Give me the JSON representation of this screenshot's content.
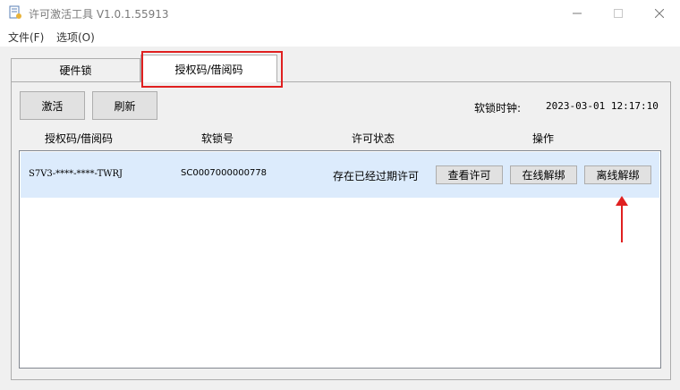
{
  "window": {
    "title": "许可激活工具 V1.0.1.55913"
  },
  "menu": [
    {
      "label": "文件(F)"
    },
    {
      "label": "选项(O)"
    }
  ],
  "tabs": [
    {
      "label": "硬件锁"
    },
    {
      "label": "授权码/借阅码"
    }
  ],
  "toolbar": {
    "activate_label": "激活",
    "refresh_label": "刷新",
    "clock_label": "软锁时钟:",
    "clock_value": "2023-03-01 12:17:10"
  },
  "table": {
    "headers": [
      "授权码/借阅码",
      "软锁号",
      "许可状态",
      "操作"
    ],
    "rows": [
      {
        "code": "S7V3-****-****-TWRJ",
        "lock_id": "SC0007000000778",
        "status": "存在已经过期许可",
        "actions": [
          "查看许可",
          "在线解绑",
          "离线解绑"
        ]
      }
    ]
  },
  "annotation_colors": {
    "highlight": "#e02020"
  }
}
